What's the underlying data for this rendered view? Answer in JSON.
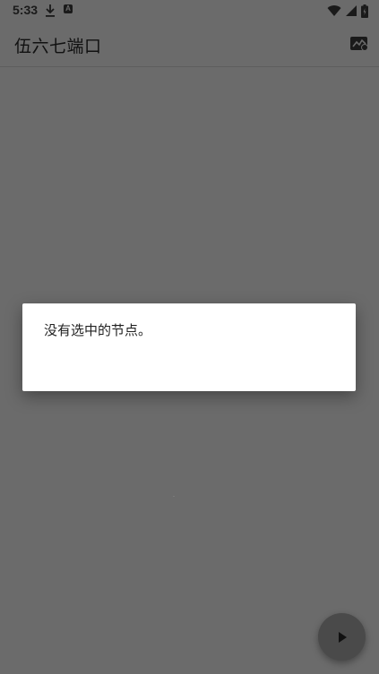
{
  "status_bar": {
    "time": "5:33",
    "icons": [
      "download-icon",
      "a-notification-icon",
      "wifi-icon",
      "signal-icon",
      "battery-icon"
    ]
  },
  "app_bar": {
    "title": "伍六七端口",
    "action_icon": "chart-icon"
  },
  "dialog": {
    "message": "没有选中的节点。"
  },
  "fab": {
    "icon": "play-icon"
  },
  "colors": {
    "scrim_background": "#6b6b6b",
    "dialog_background": "#ffffff",
    "fab_background": "#4a4a4a"
  }
}
